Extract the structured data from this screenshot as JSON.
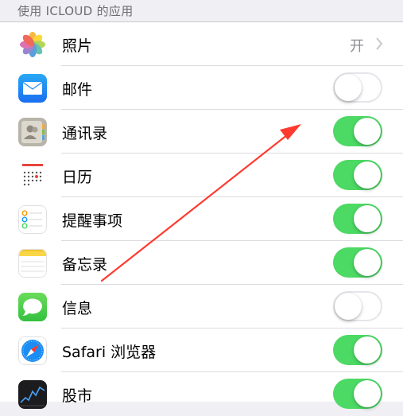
{
  "section": {
    "header": "使用 ICLOUD 的应用"
  },
  "rows": [
    {
      "label": "照片",
      "icon": "photos-icon",
      "type": "disclosure",
      "value": "开"
    },
    {
      "label": "邮件",
      "icon": "mail-icon",
      "type": "toggle",
      "on": false
    },
    {
      "label": "通讯录",
      "icon": "contacts-icon",
      "type": "toggle",
      "on": true
    },
    {
      "label": "日历",
      "icon": "calendar-icon",
      "type": "toggle",
      "on": true
    },
    {
      "label": "提醒事项",
      "icon": "reminders-icon",
      "type": "toggle",
      "on": true
    },
    {
      "label": "备忘录",
      "icon": "notes-icon",
      "type": "toggle",
      "on": true
    },
    {
      "label": "信息",
      "icon": "messages-icon",
      "type": "toggle",
      "on": false
    },
    {
      "label": "Safari 浏览器",
      "icon": "safari-icon",
      "type": "toggle",
      "on": true
    },
    {
      "label": "股市",
      "icon": "stocks-icon",
      "type": "toggle",
      "on": true
    }
  ],
  "colors": {
    "toggle_on": "#4cd964",
    "annotation_arrow": "#ff3b30",
    "background": "#efeff4"
  },
  "annotation": {
    "shape": "arrow",
    "points_to": "通讯录"
  }
}
